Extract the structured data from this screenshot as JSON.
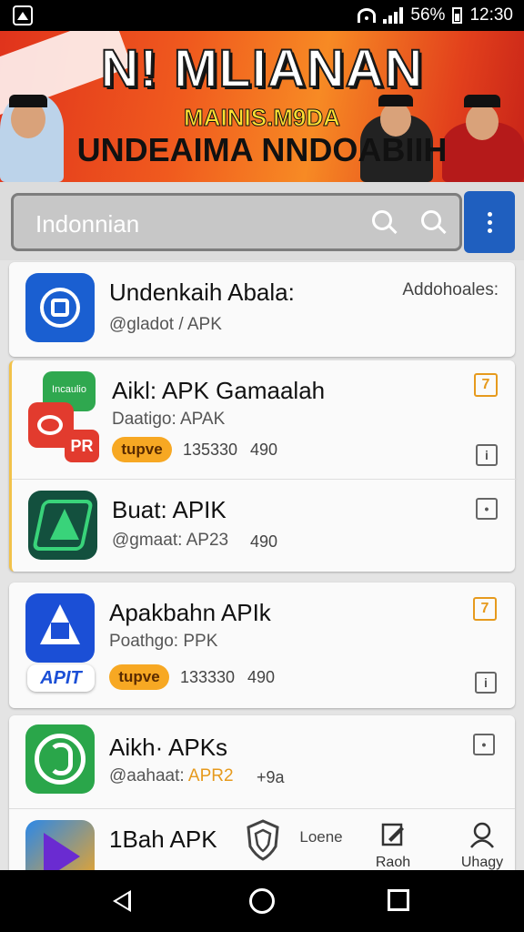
{
  "status_bar": {
    "battery_text": "56%",
    "time": "12:30"
  },
  "banner": {
    "title": "N! MLIANAN",
    "subtitle": "MAINIS.M9DA",
    "tagline": "UNDEAIMA NNDOABIIH"
  },
  "search": {
    "value": "Indonnian"
  },
  "apps": [
    {
      "name": "Undenkaih Abala:",
      "sub": "@gladot / APK",
      "side": "Addohoales:"
    },
    {
      "name": "Aikl: APK Gamaalah",
      "sub": "Daatigo: APAK",
      "pill": "tupve",
      "downloads": "135330",
      "rating": "490",
      "badge": "7",
      "icon_text_top": "Incaulio",
      "icon_text_bottom": "PR"
    },
    {
      "name": "Buat: APIK",
      "sub": "@gmaat: AP23",
      "rating": "490"
    },
    {
      "name": "Apakbahn APIk",
      "sub": "Poathgo: PPK",
      "pill": "tupve",
      "downloads": "133330",
      "rating": "490",
      "badge": "7",
      "icon_caption": "APIT"
    },
    {
      "name": "Aikh· APKs",
      "sub_prefix": "@aahaat:",
      "sub_highlight": "APR2",
      "rating": "+9a"
    },
    {
      "name": "1Bah APK",
      "sub": "..."
    }
  ],
  "bottom_tabs": [
    {
      "label": ""
    },
    {
      "label": "Loene"
    },
    {
      "label": "Raoh"
    },
    {
      "label": "Uhagy"
    }
  ],
  "colors": {
    "accent_blue": "#1f5fbf",
    "pill_orange": "#f7a823",
    "badge_orange": "#e69a1d",
    "banner_red": "#e0331c"
  }
}
